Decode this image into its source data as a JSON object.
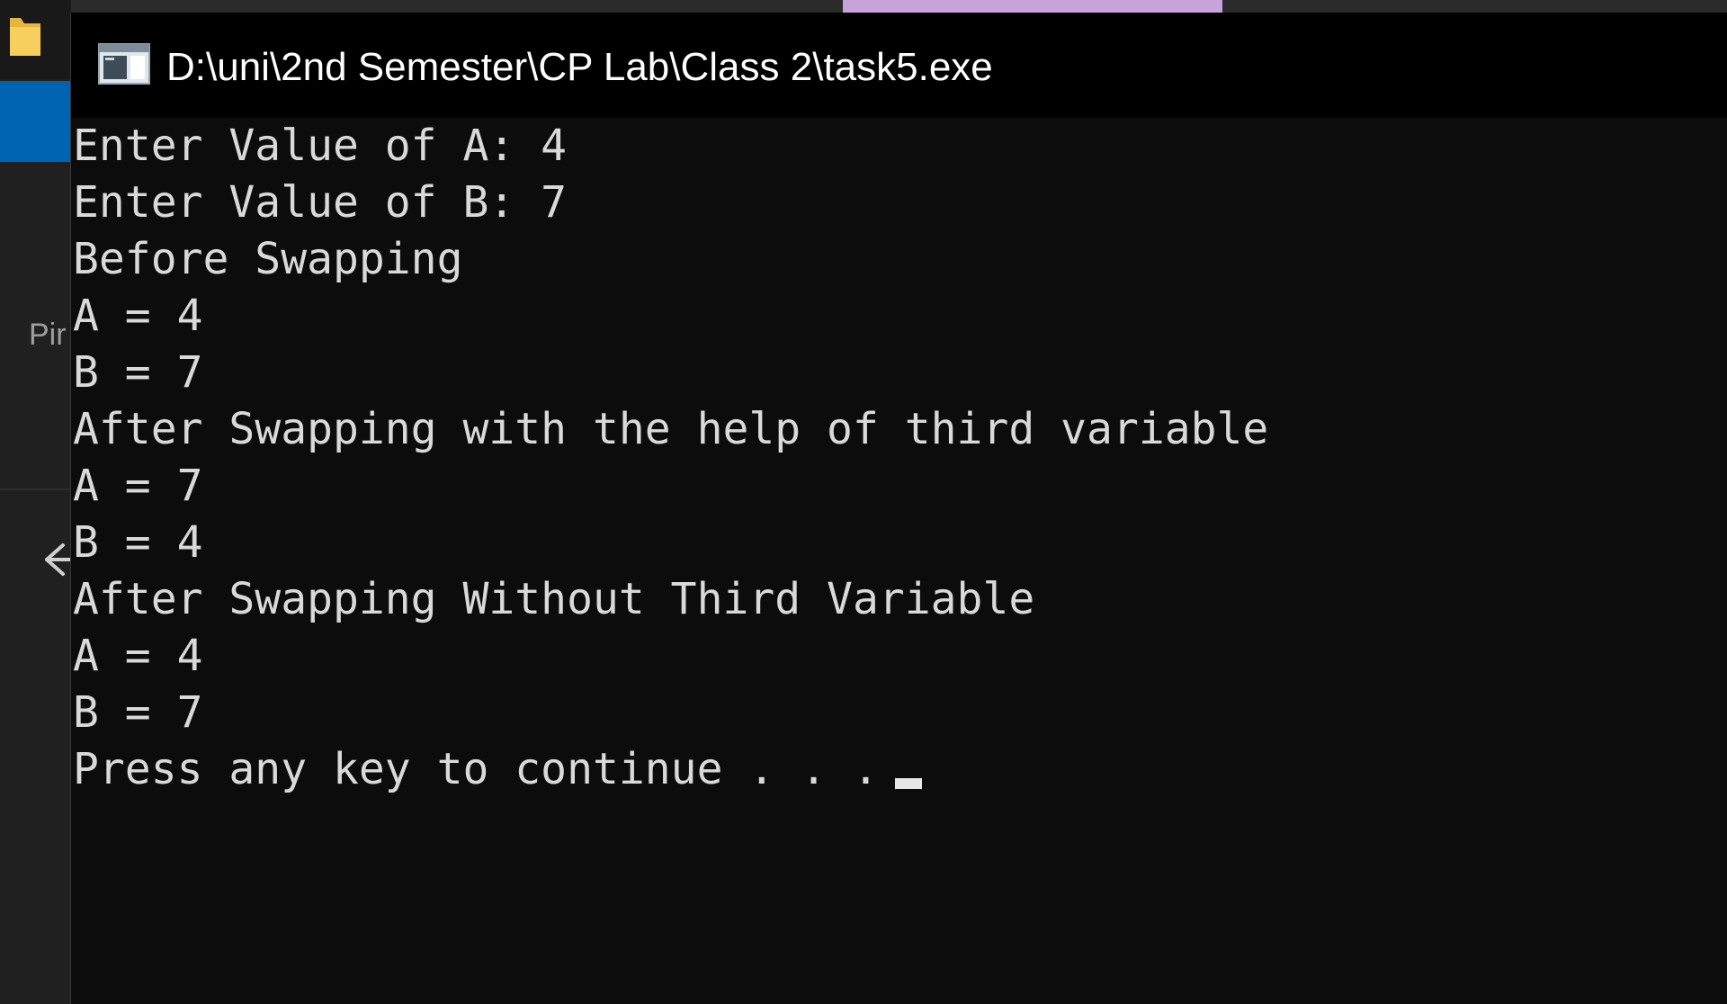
{
  "explorer": {
    "partial_text": "Pir"
  },
  "console": {
    "title": "D:\\uni\\2nd Semester\\CP Lab\\Class 2\\task5.exe",
    "lines": [
      "Enter Value of A: 4",
      "Enter Value of B: 7",
      "Before Swapping",
      "A = 4",
      "B = 7",
      "After Swapping with the help of third variable",
      "A = 7",
      "B = 4",
      "After Swapping Without Third Variable",
      "A = 4",
      "B = 7",
      "Press any key to continue . . ."
    ]
  },
  "colors": {
    "console_background": "#0c0c0c",
    "console_text": "#d9d9d9",
    "titlebar": "#000000",
    "explorer_accent": "#0063b1",
    "top_strip_accent": "#c7a2db"
  },
  "icons": {
    "folder": "folder-icon",
    "console": "console-window-icon",
    "back": "back-arrow-icon"
  }
}
